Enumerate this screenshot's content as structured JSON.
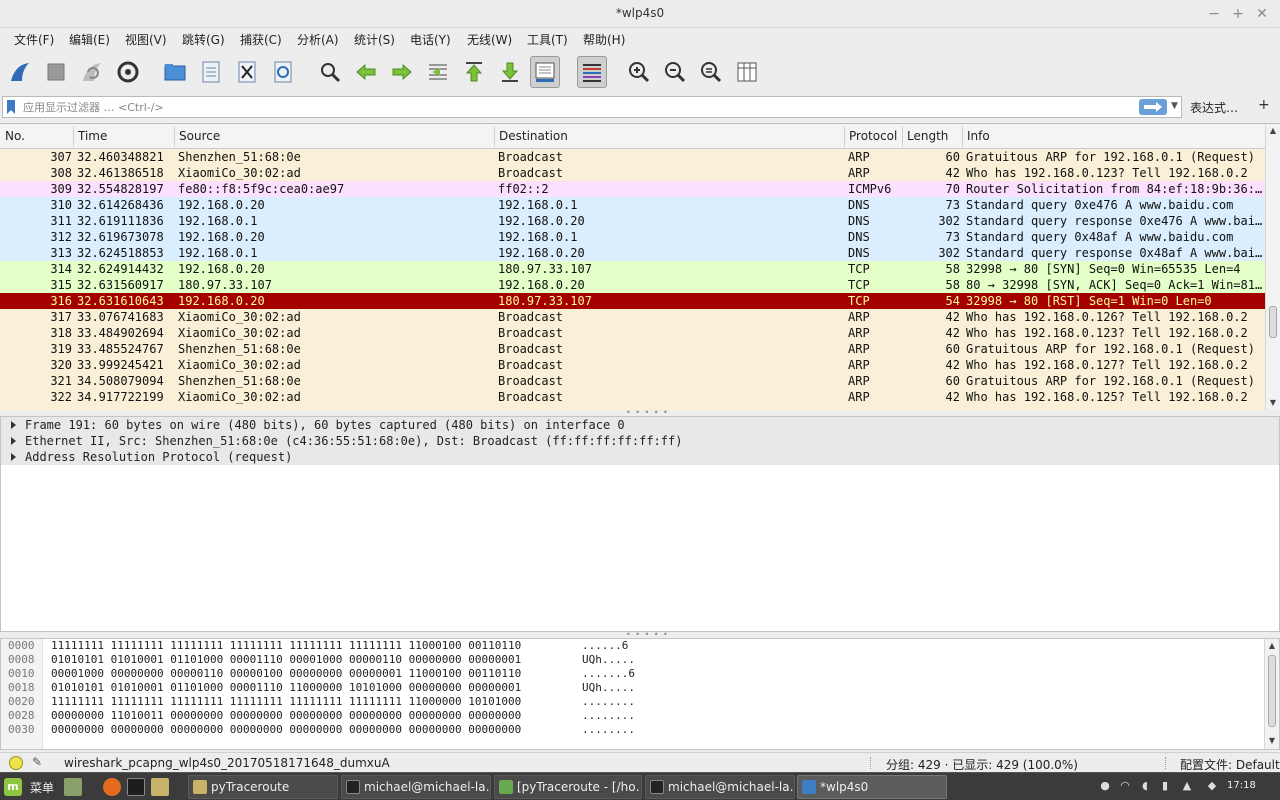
{
  "window": {
    "title": "*wlp4s0",
    "controls": {
      "minimize": "−",
      "maximize": "+",
      "close": "✕"
    }
  },
  "menu": [
    {
      "label": "文件(F)",
      "name": "menu-file"
    },
    {
      "label": "编辑(E)",
      "name": "menu-edit"
    },
    {
      "label": "视图(V)",
      "name": "menu-view"
    },
    {
      "label": "跳转(G)",
      "name": "menu-go"
    },
    {
      "label": "捕获(C)",
      "name": "menu-capture"
    },
    {
      "label": "分析(A)",
      "name": "menu-analyze"
    },
    {
      "label": "统计(S)",
      "name": "menu-statistics"
    },
    {
      "label": "电话(Y)",
      "name": "menu-telephony"
    },
    {
      "label": "无线(W)",
      "name": "menu-wireless"
    },
    {
      "label": "工具(T)",
      "name": "menu-tools"
    },
    {
      "label": "帮助(H)",
      "name": "menu-help"
    }
  ],
  "toolbar": {
    "icons": [
      "start-capture-icon",
      "stop-capture-icon",
      "restart-capture-icon",
      "capture-options-icon",
      "open-file-icon",
      "save-file-icon",
      "close-file-icon",
      "reload-file-icon",
      "find-packet-icon",
      "go-back-icon",
      "go-forward-icon",
      "go-to-packet-icon",
      "go-first-icon",
      "go-last-icon",
      "autoscroll-icon",
      "colorize-icon",
      "zoom-in-icon",
      "zoom-out-icon",
      "zoom-normal-icon",
      "resize-columns-icon"
    ]
  },
  "filter": {
    "placeholder": "应用显示过滤器 … <Ctrl-/>",
    "expression_label": "表达式…",
    "add_label": "+"
  },
  "packet_list": {
    "columns": [
      "No.",
      "Time",
      "Source",
      "Destination",
      "Protocol",
      "Length",
      "Info"
    ],
    "rows": [
      {
        "no": "307",
        "time": "32.460348821",
        "src": "Shenzhen_51:68:0e",
        "dst": "Broadcast",
        "proto": "ARP",
        "len": "60",
        "info": "Gratuitous ARP for 192.168.0.1 (Request)",
        "bg": "#faf0d7",
        "fg": "#121212"
      },
      {
        "no": "308",
        "time": "32.461386518",
        "src": "XiaomiCo_30:02:ad",
        "dst": "Broadcast",
        "proto": "ARP",
        "len": "42",
        "info": "Who has 192.168.0.123? Tell 192.168.0.2",
        "bg": "#faf0d7",
        "fg": "#121212"
      },
      {
        "no": "309",
        "time": "32.554828197",
        "src": "fe80::f8:5f9c:cea0:ae97",
        "dst": "ff02::2",
        "proto": "ICMPv6",
        "len": "70",
        "info": "Router Solicitation from 84:ef:18:9b:36:…",
        "bg": "#fce0ff",
        "fg": "#121212"
      },
      {
        "no": "310",
        "time": "32.614268436",
        "src": "192.168.0.20",
        "dst": "192.168.0.1",
        "proto": "DNS",
        "len": "73",
        "info": "Standard query 0xe476 A www.baidu.com",
        "bg": "#daeeff",
        "fg": "#121212"
      },
      {
        "no": "311",
        "time": "32.619111836",
        "src": "192.168.0.1",
        "dst": "192.168.0.20",
        "proto": "DNS",
        "len": "302",
        "info": "Standard query response 0xe476 A www.bai…",
        "bg": "#daeeff",
        "fg": "#121212"
      },
      {
        "no": "312",
        "time": "32.619673078",
        "src": "192.168.0.20",
        "dst": "192.168.0.1",
        "proto": "DNS",
        "len": "73",
        "info": "Standard query 0x48af A www.baidu.com",
        "bg": "#daeeff",
        "fg": "#121212"
      },
      {
        "no": "313",
        "time": "32.624518853",
        "src": "192.168.0.1",
        "dst": "192.168.0.20",
        "proto": "DNS",
        "len": "302",
        "info": "Standard query response 0x48af A www.bai…",
        "bg": "#daeeff",
        "fg": "#121212"
      },
      {
        "no": "314",
        "time": "32.624914432",
        "src": "192.168.0.20",
        "dst": "180.97.33.107",
        "proto": "TCP",
        "len": "58",
        "info": "32998 → 80 [SYN] Seq=0 Win=65535 Len=4",
        "bg": "#e4ffc7",
        "fg": "#121212"
      },
      {
        "no": "315",
        "time": "32.631560917",
        "src": "180.97.33.107",
        "dst": "192.168.0.20",
        "proto": "TCP",
        "len": "58",
        "info": "80 → 32998 [SYN, ACK] Seq=0 Ack=1 Win=81…",
        "bg": "#e4ffc7",
        "fg": "#121212"
      },
      {
        "no": "316",
        "time": "32.631610643",
        "src": "192.168.0.20",
        "dst": "180.97.33.107",
        "proto": "TCP",
        "len": "54",
        "info": "32998 → 80 [RST] Seq=1 Win=0 Len=0",
        "bg": "#a40000",
        "fg": "#fffc9c"
      },
      {
        "no": "317",
        "time": "33.076741683",
        "src": "XiaomiCo_30:02:ad",
        "dst": "Broadcast",
        "proto": "ARP",
        "len": "42",
        "info": "Who has 192.168.0.126? Tell 192.168.0.2",
        "bg": "#faf0d7",
        "fg": "#121212"
      },
      {
        "no": "318",
        "time": "33.484902694",
        "src": "XiaomiCo_30:02:ad",
        "dst": "Broadcast",
        "proto": "ARP",
        "len": "42",
        "info": "Who has 192.168.0.123? Tell 192.168.0.2",
        "bg": "#faf0d7",
        "fg": "#121212"
      },
      {
        "no": "319",
        "time": "33.485524767",
        "src": "Shenzhen_51:68:0e",
        "dst": "Broadcast",
        "proto": "ARP",
        "len": "60",
        "info": "Gratuitous ARP for 192.168.0.1 (Request)",
        "bg": "#faf0d7",
        "fg": "#121212"
      },
      {
        "no": "320",
        "time": "33.999245421",
        "src": "XiaomiCo_30:02:ad",
        "dst": "Broadcast",
        "proto": "ARP",
        "len": "42",
        "info": "Who has 192.168.0.127? Tell 192.168.0.2",
        "bg": "#faf0d7",
        "fg": "#121212"
      },
      {
        "no": "321",
        "time": "34.508079094",
        "src": "Shenzhen_51:68:0e",
        "dst": "Broadcast",
        "proto": "ARP",
        "len": "60",
        "info": "Gratuitous ARP for 192.168.0.1 (Request)",
        "bg": "#faf0d7",
        "fg": "#121212"
      },
      {
        "no": "322",
        "time": "34.917722199",
        "src": "XiaomiCo_30:02:ad",
        "dst": "Broadcast",
        "proto": "ARP",
        "len": "42",
        "info": "Who has 192.168.0.125? Tell 192.168.0.2",
        "bg": "#faf0d7",
        "fg": "#121212"
      }
    ]
  },
  "details": [
    {
      "text": "Frame 191: 60 bytes on wire (480 bits), 60 bytes captured (480 bits) on interface 0",
      "selected": true
    },
    {
      "text": "Ethernet II, Src: Shenzhen_51:68:0e (c4:36:55:51:68:0e), Dst: Broadcast (ff:ff:ff:ff:ff:ff)",
      "selected": true
    },
    {
      "text": "Address Resolution Protocol (request)",
      "selected": true
    }
  ],
  "hex": [
    {
      "off": "0000",
      "bits": "11111111 11111111 11111111 11111111 11111111 11111111 11000100 00110110",
      "ascii": "......6"
    },
    {
      "off": "0008",
      "bits": "01010101 01010001 01101000 00001110 00001000 00000110 00000000 00000001",
      "ascii": "UQh....."
    },
    {
      "off": "0010",
      "bits": "00001000 00000000 00000110 00000100 00000000 00000001 11000100 00110110",
      "ascii": ".......6"
    },
    {
      "off": "0018",
      "bits": "01010101 01010001 01101000 00001110 11000000 10101000 00000000 00000001",
      "ascii": "UQh....."
    },
    {
      "off": "0020",
      "bits": "11111111 11111111 11111111 11111111 11111111 11111111 11000000 10101000",
      "ascii": "........"
    },
    {
      "off": "0028",
      "bits": "00000000 11010011 00000000 00000000 00000000 00000000 00000000 00000000",
      "ascii": "........"
    },
    {
      "off": "0030",
      "bits": "00000000 00000000 00000000 00000000 00000000 00000000 00000000 00000000",
      "ascii": "........"
    }
  ],
  "status": {
    "file": "wireshark_pcapng_wlp4s0_20170518171648_dumxuA",
    "packets": "分组: 429 · 已显示: 429 (100.0%)",
    "profile": "配置文件: Default"
  },
  "taskbar": {
    "menu_label": "菜单",
    "tasks": [
      {
        "label": "pyTraceroute",
        "active": false,
        "icon_color": "#c9b26a"
      },
      {
        "label": "michael@michael-la…",
        "active": false,
        "icon_color": "#222"
      },
      {
        "label": "[pyTraceroute - [/ho…",
        "active": false,
        "icon_color": "#6aa84f"
      },
      {
        "label": "michael@michael-la…",
        "active": false,
        "icon_color": "#222"
      },
      {
        "label": "*wlp4s0",
        "active": true,
        "icon_color": "#3d7fc4"
      }
    ],
    "clock": "17:18"
  }
}
